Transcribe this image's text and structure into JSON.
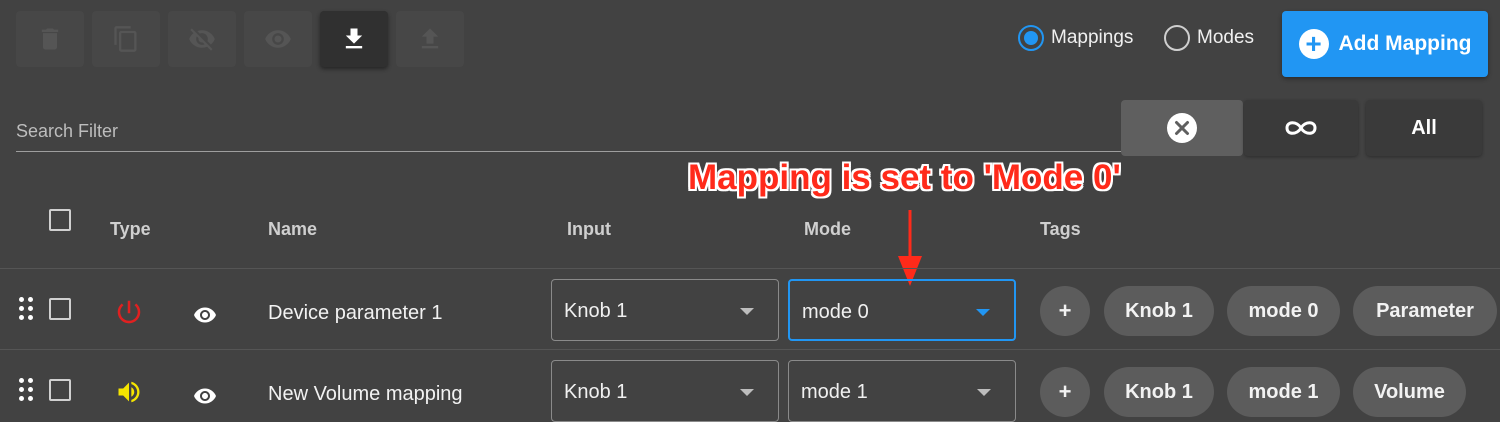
{
  "toolbar": {
    "buttons": [
      {
        "icon": "trash-icon",
        "enabled": false
      },
      {
        "icon": "copy-icon",
        "enabled": false
      },
      {
        "icon": "eye-off-icon",
        "enabled": false
      },
      {
        "icon": "eye-icon",
        "enabled": false
      },
      {
        "icon": "download-icon",
        "enabled": true
      },
      {
        "icon": "upload-icon",
        "enabled": false
      }
    ]
  },
  "view_toggle": {
    "mappings_label": "Mappings",
    "modes_label": "Modes",
    "selected": "Mappings"
  },
  "add_button": {
    "label": "Add Mapping",
    "icon": "plus-circle-icon"
  },
  "search": {
    "placeholder": "Search Filter",
    "value": ""
  },
  "filters": {
    "clear_icon": "close-circle-icon",
    "infinity_icon": "infinity-icon",
    "all_label": "All",
    "selected": "clear"
  },
  "annotation": {
    "text": "Mapping is set to 'Mode 0'",
    "color": "#ff2a1a"
  },
  "table": {
    "headers": {
      "type": "Type",
      "name": "Name",
      "input": "Input",
      "mode": "Mode",
      "tags": "Tags"
    },
    "rows": [
      {
        "type_icon": "power-icon",
        "type_color": "#e02020",
        "visibility_icon": "eye-icon",
        "name": "Device parameter 1",
        "input": "Knob 1",
        "mode": "mode 0",
        "mode_focused": true,
        "tags": [
          "Knob 1",
          "mode 0",
          "Parameter"
        ]
      },
      {
        "type_icon": "speaker-icon",
        "type_color": "#f5e400",
        "visibility_icon": "eye-icon",
        "name": "New Volume mapping",
        "input": "Knob 1",
        "mode": "mode 1",
        "mode_focused": false,
        "tags": [
          "Knob 1",
          "mode 1",
          "Volume"
        ]
      }
    ],
    "add_tag_label": "+"
  },
  "colors": {
    "accent": "#2196f3",
    "background": "#424242",
    "chip": "#5c5c5c"
  }
}
